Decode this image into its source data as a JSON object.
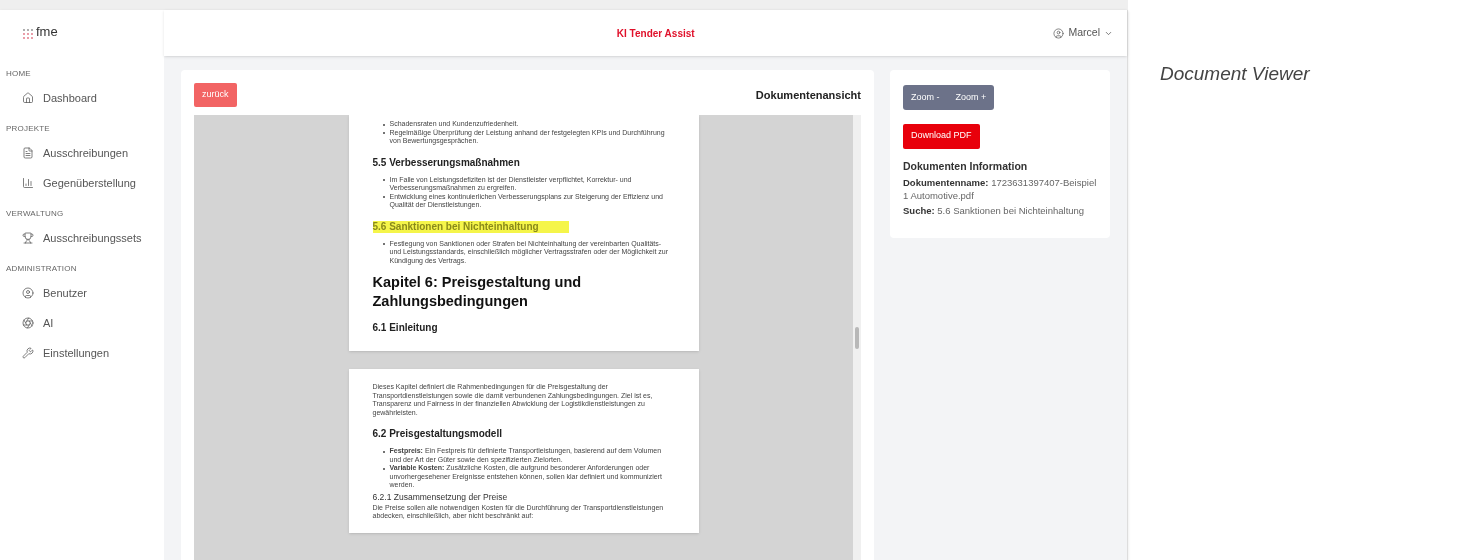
{
  "logo": {
    "text": "fme"
  },
  "header": {
    "title": "KI Tender Assist",
    "user": "Marcel"
  },
  "sidebar": {
    "sections": [
      {
        "title": "HOME",
        "items": [
          {
            "label": "Dashboard"
          }
        ]
      },
      {
        "title": "PROJEKTE",
        "items": [
          {
            "label": "Ausschreibungen"
          },
          {
            "label": "Gegenüberstellung"
          }
        ]
      },
      {
        "title": "VERWALTUNG",
        "items": [
          {
            "label": "Ausschreibungssets"
          }
        ]
      },
      {
        "title": "ADMINISTRATION",
        "items": [
          {
            "label": "Benutzer"
          },
          {
            "label": "AI"
          },
          {
            "label": "Einstellungen"
          }
        ]
      }
    ]
  },
  "viewer": {
    "back_button": "zurück",
    "title": "Dokumentenansicht",
    "pages": [
      {
        "blocks": [
          {
            "kind": "bullets",
            "items": [
              "Schadensraten und Kundenzufriedenheit.",
              "Regelmäßige Überprüfung der Leistung anhand der festgelegten KPIs und Durchführung von Bewertungsgesprächen."
            ]
          },
          {
            "kind": "heading",
            "text": "5.5 Verbesserungsmaßnahmen",
            "highlight": false
          },
          {
            "kind": "bullets",
            "items": [
              "Im Falle von Leistungsdefiziten ist der Dienstleister verpflichtet, Korrektur- und Verbesserungsmaßnahmen zu ergreifen.",
              "Entwicklung eines kontinuierlichen Verbesserungsplans zur Steigerung der Effizienz und Qualität der Dienstleistungen."
            ]
          },
          {
            "kind": "heading",
            "text": "5.6 Sanktionen bei Nichteinhaltung",
            "highlight": true
          },
          {
            "kind": "bullets",
            "items": [
              "Festlegung von Sanktionen oder Strafen bei Nichteinhaltung der vereinbarten Qualitäts- und Leistungsstandards, einschließlich möglicher Vertragsstrafen oder der Möglichkeit zur Kündigung des Vertrags."
            ]
          },
          {
            "kind": "chapter",
            "text": "Kapitel 6: Preisgestaltung und Zahlungsbedingungen"
          },
          {
            "kind": "heading",
            "text": "6.1 Einleitung",
            "highlight": false
          }
        ]
      },
      {
        "blocks": [
          {
            "kind": "paragraph",
            "text": "Dieses Kapitel definiert die Rahmenbedingungen für die Preisgestaltung der Transportdienstleistungen sowie die damit verbundenen Zahlungsbedingungen. Ziel ist es, Transparenz und Fairness in der finanziellen Abwicklung der Logistikdienstleistungen zu gewährleisten."
          },
          {
            "kind": "heading",
            "text": "6.2 Preisgestaltungsmodell",
            "highlight": false
          },
          {
            "kind": "bullets",
            "items": [
              "**Festpreis:** Ein Festpreis für definierte Transportleistungen, basierend auf dem Volumen und der Art der Güter sowie den spezifizierten Zielorten.",
              "**Variable Kosten:** Zusätzliche Kosten, die aufgrund besonderer Anforderungen oder unvorhergesehener Ereignisse entstehen können, sollen klar definiert und kommuniziert werden."
            ]
          },
          {
            "kind": "subheading",
            "text": "6.2.1 Zusammensetzung der Preise"
          },
          {
            "kind": "paragraph",
            "text": "Die Preise sollen alle notwendigen Kosten für die Durchführung der Transportdienstleistungen abdecken, einschließlich, aber nicht beschränkt auf:"
          }
        ]
      }
    ]
  },
  "panel": {
    "zoom_out": "Zoom -",
    "zoom_in": "Zoom +",
    "download": "Download PDF",
    "info_title": "Dokumenten Information",
    "fields": [
      {
        "label": "Dokumentenname:",
        "value": "1723631397407-Beispiel 1 Automotive.pdf"
      },
      {
        "label": "Suche:",
        "value": "5.6 Sanktionen bei Nichteinhaltung"
      }
    ]
  },
  "caption": "Document Viewer"
}
